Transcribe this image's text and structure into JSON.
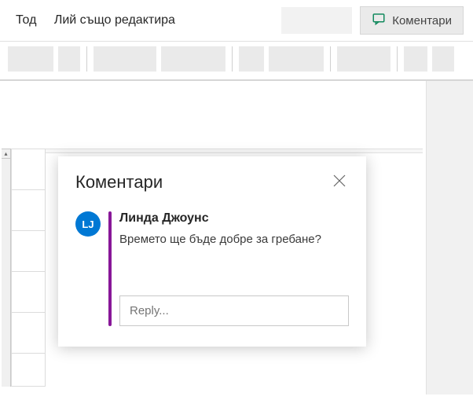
{
  "header": {
    "tod_label": "Тод",
    "editing_label": "Лий също редактира",
    "comments_button": "Коментари"
  },
  "comments_panel": {
    "title": "Коментари",
    "thread": {
      "avatar_initials": "LJ",
      "author": "Линда Джоунс",
      "body": "Времето ще бъде добре за гребане?"
    },
    "reply_placeholder": "Reply..."
  },
  "colors": {
    "accent": "#881798",
    "avatar": "#0078d4"
  }
}
